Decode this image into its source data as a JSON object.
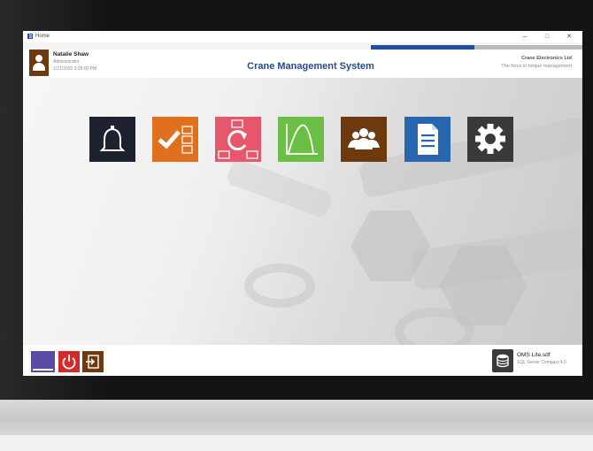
{
  "window": {
    "title": "Home",
    "minimize": "–",
    "maximize": "□",
    "close": "✕"
  },
  "progress": {
    "fraction": 0.49
  },
  "user": {
    "name": "Natalie Shaw",
    "role": "Administrator",
    "datetime": "1/21/2020 3:28:00 PM"
  },
  "app_title": "Crane Management System",
  "company": {
    "name": "Crane Electronics Ltd",
    "tagline": "The force in torque management"
  },
  "tiles": [
    {
      "icon": "bell-icon",
      "color": "#1c2230"
    },
    {
      "icon": "checklist-icon",
      "color": "#e0701e"
    },
    {
      "icon": "refresh-cycle-icon",
      "color": "#e8566c"
    },
    {
      "icon": "curve-graph-icon",
      "color": "#6cbf45"
    },
    {
      "icon": "users-group-icon",
      "color": "#6d3a10"
    },
    {
      "icon": "document-icon",
      "color": "#2866b0"
    },
    {
      "icon": "gear-icon",
      "color": "#3a3a3a"
    }
  ],
  "footer": {
    "buttons": [
      {
        "icon": "minimize-bar-icon",
        "color": "#5b4aa8"
      },
      {
        "icon": "power-icon",
        "color": "#d62828"
      },
      {
        "icon": "logout-icon",
        "color": "#6d3a10"
      }
    ],
    "database": {
      "name": "OMS Lite.sdf",
      "type": "SQL Server Compact 4.0"
    }
  }
}
